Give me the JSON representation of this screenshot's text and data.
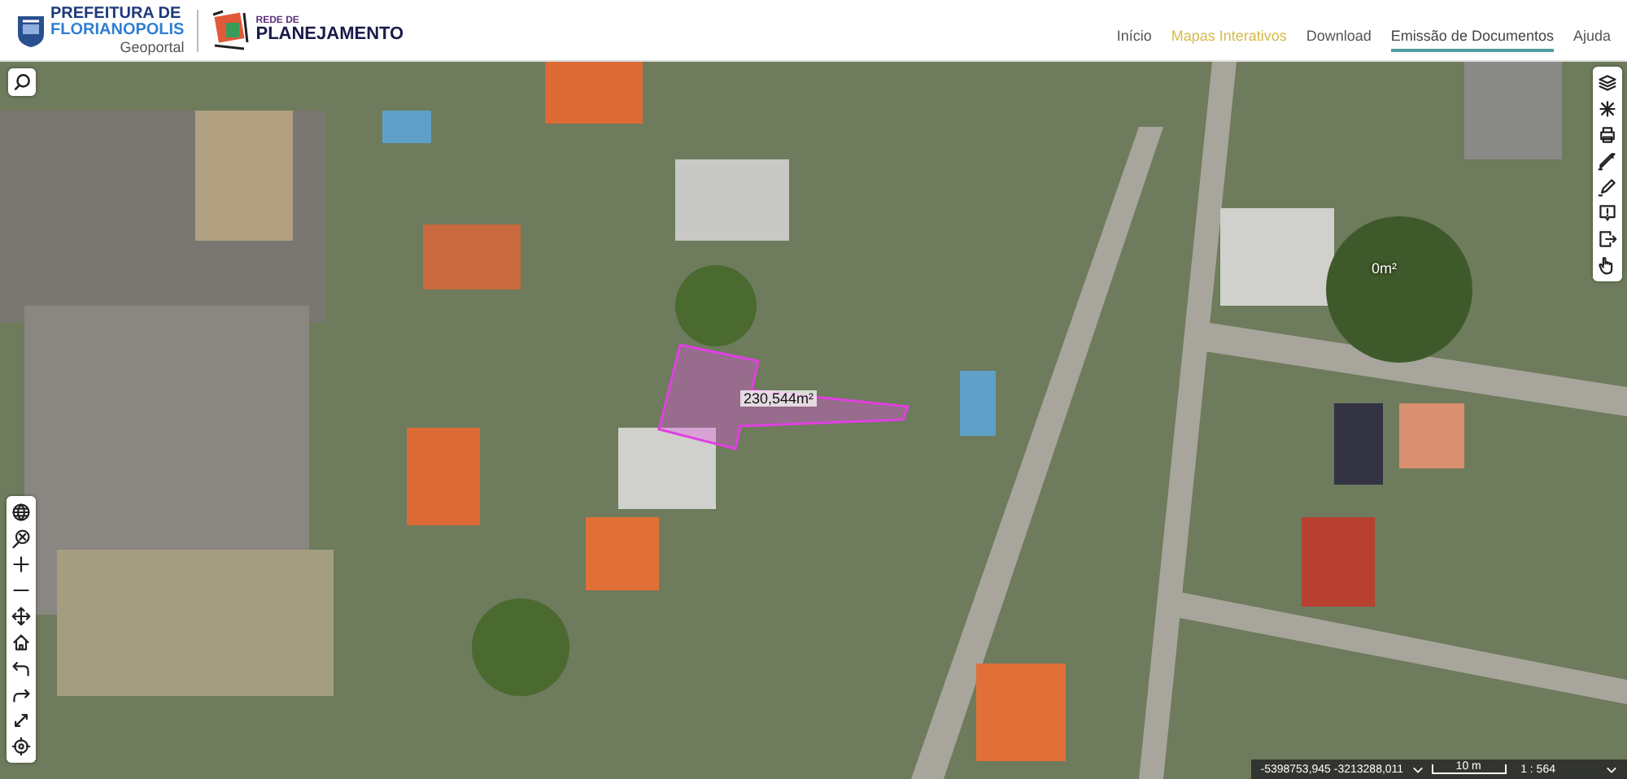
{
  "header": {
    "city_logo": {
      "line_1": "PREFEITURA DE",
      "line_2": "FLORIANOPOLIS",
      "subtitle": "Geoportal"
    },
    "planning_logo": {
      "line_1": "REDE DE",
      "line_2": "PLANEJAMENTO"
    }
  },
  "nav": [
    {
      "label": "Início",
      "selected": false,
      "highlighted": false
    },
    {
      "label": "Mapas Interativos",
      "selected": false,
      "highlighted": true
    },
    {
      "label": "Download",
      "selected": false,
      "highlighted": false
    },
    {
      "label": "Emissão de Documentos",
      "selected": true,
      "highlighted": false
    },
    {
      "label": "Ajuda",
      "selected": false,
      "highlighted": false
    }
  ],
  "map": {
    "labels": [
      {
        "kind": "area",
        "text": "230,544m²"
      },
      {
        "kind": "plain",
        "text": "0m²"
      }
    ],
    "status_bar": {
      "coordinates": "-5398753,945 -3213288,011",
      "scale_bar": "10 m",
      "scale": "1 : 564"
    }
  }
}
